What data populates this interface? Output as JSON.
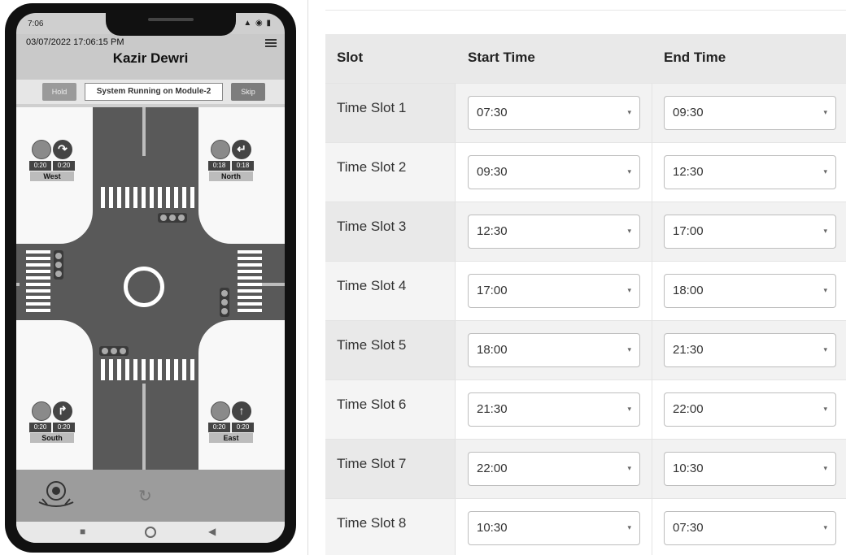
{
  "phone": {
    "status_time": "7:06",
    "status_icons": "▲ ◉ ▮",
    "datetime": "03/07/2022  17:06:15 PM",
    "title": "Kazir Dewri",
    "hold_label": "Hold",
    "status_text": "System Running on Module-2",
    "skip_label": "Skip",
    "signals": {
      "west": {
        "arrow": "↷",
        "timer1": "0:20",
        "timer2": "0:20",
        "label": "West"
      },
      "north": {
        "arrow": "↵",
        "timer1": "0:18",
        "timer2": "0:18",
        "label": "North"
      },
      "south": {
        "arrow": "↱",
        "timer1": "0:20",
        "timer2": "0:20",
        "label": "South"
      },
      "east": {
        "arrow": "↑",
        "timer1": "0:20",
        "timer2": "0:20",
        "label": "East"
      }
    },
    "reload_glyph": "↻",
    "nav": {
      "recent": "■",
      "back": "◀"
    }
  },
  "table": {
    "headers": {
      "slot": "Slot",
      "start": "Start Time",
      "end": "End Time"
    },
    "rows": [
      {
        "slot": "Time Slot 1",
        "start": "07:30",
        "end": "09:30"
      },
      {
        "slot": "Time Slot 2",
        "start": "09:30",
        "end": "12:30"
      },
      {
        "slot": "Time Slot 3",
        "start": "12:30",
        "end": "17:00"
      },
      {
        "slot": "Time Slot 4",
        "start": "17:00",
        "end": "18:00"
      },
      {
        "slot": "Time Slot 5",
        "start": "18:00",
        "end": "21:30"
      },
      {
        "slot": "Time Slot 6",
        "start": "21:30",
        "end": "22:00"
      },
      {
        "slot": "Time Slot 7",
        "start": "22:00",
        "end": "10:30"
      },
      {
        "slot": "Time Slot 8",
        "start": "10:30",
        "end": "07:30"
      }
    ],
    "chevron": "▾"
  }
}
